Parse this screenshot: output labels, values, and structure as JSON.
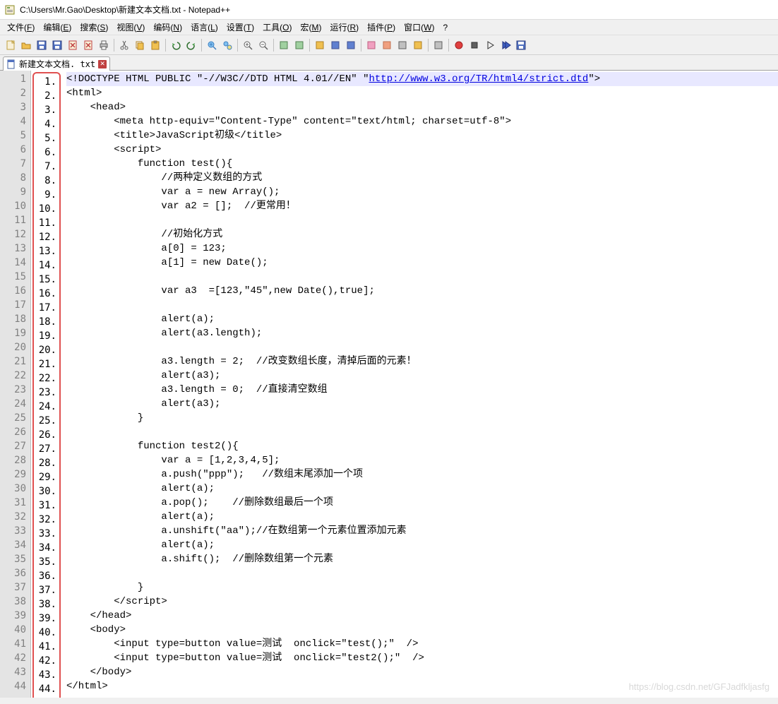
{
  "title": "C:\\Users\\Mr.Gao\\Desktop\\新建文本文档.txt - Notepad++",
  "menus": [
    "文件(F)",
    "编辑(E)",
    "搜索(S)",
    "视图(V)",
    "编码(N)",
    "语言(L)",
    "设置(T)",
    "工具(O)",
    "宏(M)",
    "运行(R)",
    "插件(P)",
    "窗口(W)",
    "?"
  ],
  "menu_underline": [
    "F",
    "E",
    "S",
    "V",
    "N",
    "L",
    "T",
    "O",
    "M",
    "R",
    "P",
    "W",
    ""
  ],
  "tab": {
    "label": "新建文本文档. txt",
    "close": "✕"
  },
  "line_count": 44,
  "code_lines": [
    "<!DOCTYPE HTML PUBLIC \"-//W3C//DTD HTML 4.01//EN\" \"http://www.w3.org/TR/html4/strict.dtd\">",
    "<html>",
    "    <head>",
    "        <meta http-equiv=\"Content-Type\" content=\"text/html; charset=utf-8\">",
    "        <title>JavaScript初级</title>",
    "        <script>",
    "            function test(){",
    "                //两种定义数组的方式",
    "                var a = new Array();",
    "                var a2 = [];  //更常用！",
    "",
    "                //初始化方式",
    "                a[0] = 123;",
    "                a[1] = new Date();",
    "",
    "                var a3  =[123,\"45\",new Date(),true];",
    "",
    "                alert(a);",
    "                alert(a3.length);",
    "",
    "                a3.length = 2;  //改变数组长度，清掉后面的元素！",
    "                alert(a3);",
    "                a3.length = 0;  //直接清空数组",
    "                alert(a3);",
    "            }",
    "",
    "            function test2(){",
    "                var a = [1,2,3,4,5];",
    "                a.push(\"ppp\");   //数组末尾添加一个项",
    "                alert(a);",
    "                a.pop();    //删除数组最后一个项",
    "                alert(a);",
    "                a.unshift(\"aa\");//在数组第一个元素位置添加元素",
    "                alert(a);",
    "                a.shift();  //删除数组第一个元素",
    "",
    "            }",
    "        </script>",
    "    </head>",
    "    <body>",
    "        <input type=button value=测试  onclick=\"test();\"  />",
    "        <input type=button value=测试  onclick=\"test2();\"  />",
    "    </body>",
    "</html>"
  ],
  "watermark": "https://blog.csdn.net/GFJadfkljasfg",
  "toolbar_icons": [
    {
      "name": "new-file-icon",
      "color": "#f8f0d8",
      "stroke": "#c0a040"
    },
    {
      "name": "open-file-icon",
      "color": "#f0c050",
      "stroke": "#b08020"
    },
    {
      "name": "save-icon",
      "color": "#5070c0",
      "stroke": "#304080"
    },
    {
      "name": "save-all-icon",
      "color": "#5070c0",
      "stroke": "#304080"
    },
    {
      "name": "close-icon",
      "color": "#f8f0d8",
      "stroke": "#c04040"
    },
    {
      "name": "close-all-icon",
      "color": "#f8f0d8",
      "stroke": "#c04040"
    },
    {
      "name": "print-icon",
      "color": "#c0c0c0",
      "stroke": "#606060"
    },
    {
      "name": "sep"
    },
    {
      "name": "cut-icon",
      "color": "#c0c0c0",
      "stroke": "#606060"
    },
    {
      "name": "copy-icon",
      "color": "#f0c050",
      "stroke": "#b08020"
    },
    {
      "name": "paste-icon",
      "color": "#f0c050",
      "stroke": "#b08020"
    },
    {
      "name": "sep"
    },
    {
      "name": "undo-icon",
      "color": "#50a050",
      "stroke": "#307030"
    },
    {
      "name": "redo-icon",
      "color": "#50a050",
      "stroke": "#307030"
    },
    {
      "name": "sep"
    },
    {
      "name": "find-icon",
      "color": "#80c0f0",
      "stroke": "#4080c0"
    },
    {
      "name": "replace-icon",
      "color": "#80c0f0",
      "stroke": "#4080c0"
    },
    {
      "name": "sep"
    },
    {
      "name": "zoom-in-icon",
      "color": "#fff",
      "stroke": "#606060"
    },
    {
      "name": "zoom-out-icon",
      "color": "#fff",
      "stroke": "#606060"
    },
    {
      "name": "sep"
    },
    {
      "name": "sync-v-icon",
      "color": "#a0d0a0",
      "stroke": "#508050"
    },
    {
      "name": "sync-h-icon",
      "color": "#a0d0a0",
      "stroke": "#508050"
    },
    {
      "name": "sep"
    },
    {
      "name": "wrap-icon",
      "color": "#f0c050",
      "stroke": "#b08020"
    },
    {
      "name": "all-chars-icon",
      "color": "#6080d0",
      "stroke": "#405090"
    },
    {
      "name": "indent-icon",
      "color": "#6080d0",
      "stroke": "#405090"
    },
    {
      "name": "sep"
    },
    {
      "name": "lang-icon",
      "color": "#f0a0c0",
      "stroke": "#c06080"
    },
    {
      "name": "doc-map-icon",
      "color": "#f0a080",
      "stroke": "#c07050"
    },
    {
      "name": "func-list-icon",
      "color": "#c0c0c0",
      "stroke": "#606060"
    },
    {
      "name": "folder-icon",
      "color": "#f0c050",
      "stroke": "#b08020"
    },
    {
      "name": "sep"
    },
    {
      "name": "monitor-icon",
      "color": "#c0c0c0",
      "stroke": "#606060"
    },
    {
      "name": "sep"
    },
    {
      "name": "record-icon",
      "color": "#e04040",
      "stroke": "#a02020"
    },
    {
      "name": "stop-icon",
      "color": "#606060",
      "stroke": "#303030"
    },
    {
      "name": "play-icon",
      "color": "#606060",
      "stroke": "#303030"
    },
    {
      "name": "play-multi-icon",
      "color": "#4060c0",
      "stroke": "#203080"
    },
    {
      "name": "save-macro-icon",
      "color": "#5070c0",
      "stroke": "#304080"
    }
  ]
}
